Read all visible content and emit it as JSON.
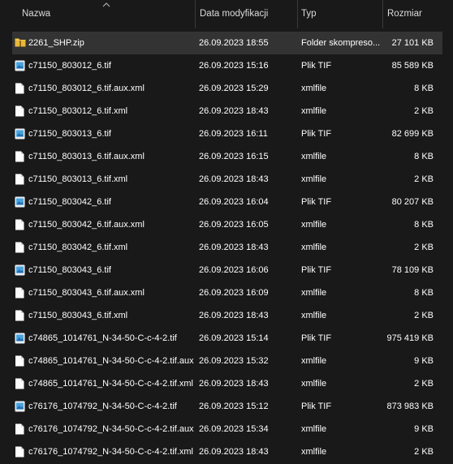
{
  "header": {
    "name": "Nazwa",
    "date": "Data modyfikacji",
    "type": "Typ",
    "size": "Rozmiar"
  },
  "colors": {
    "background": "#191919",
    "selected_row": "#333333",
    "folder_icon": "#f2c94c",
    "tif_icon": "#4aa3df"
  },
  "files": [
    {
      "name": "2261_SHP.zip",
      "date": "26.09.2023 18:55",
      "type": "Folder skompreso...",
      "size": "27 101 KB",
      "icon": "zip-folder-icon",
      "selected": true
    },
    {
      "name": "c71150_803012_6.tif",
      "date": "26.09.2023 15:16",
      "type": "Plik TIF",
      "size": "85 589 KB",
      "icon": "tif-image-icon"
    },
    {
      "name": "c71150_803012_6.tif.aux.xml",
      "date": "26.09.2023 15:29",
      "type": "xmlfile",
      "size": "8 KB",
      "icon": "xml-file-icon"
    },
    {
      "name": "c71150_803012_6.tif.xml",
      "date": "26.09.2023 18:43",
      "type": "xmlfile",
      "size": "2 KB",
      "icon": "xml-file-icon"
    },
    {
      "name": "c71150_803013_6.tif",
      "date": "26.09.2023 16:11",
      "type": "Plik TIF",
      "size": "82 699 KB",
      "icon": "tif-image-icon"
    },
    {
      "name": "c71150_803013_6.tif.aux.xml",
      "date": "26.09.2023 16:15",
      "type": "xmlfile",
      "size": "8 KB",
      "icon": "xml-file-icon"
    },
    {
      "name": "c71150_803013_6.tif.xml",
      "date": "26.09.2023 18:43",
      "type": "xmlfile",
      "size": "2 KB",
      "icon": "xml-file-icon"
    },
    {
      "name": "c71150_803042_6.tif",
      "date": "26.09.2023 16:04",
      "type": "Plik TIF",
      "size": "80 207 KB",
      "icon": "tif-image-icon"
    },
    {
      "name": "c71150_803042_6.tif.aux.xml",
      "date": "26.09.2023 16:05",
      "type": "xmlfile",
      "size": "8 KB",
      "icon": "xml-file-icon"
    },
    {
      "name": "c71150_803042_6.tif.xml",
      "date": "26.09.2023 18:43",
      "type": "xmlfile",
      "size": "2 KB",
      "icon": "xml-file-icon"
    },
    {
      "name": "c71150_803043_6.tif",
      "date": "26.09.2023 16:06",
      "type": "Plik TIF",
      "size": "78 109 KB",
      "icon": "tif-image-icon"
    },
    {
      "name": "c71150_803043_6.tif.aux.xml",
      "date": "26.09.2023 16:09",
      "type": "xmlfile",
      "size": "8 KB",
      "icon": "xml-file-icon"
    },
    {
      "name": "c71150_803043_6.tif.xml",
      "date": "26.09.2023 18:43",
      "type": "xmlfile",
      "size": "2 KB",
      "icon": "xml-file-icon"
    },
    {
      "name": "c74865_1014761_N-34-50-C-c-4-2.tif",
      "date": "26.09.2023 15:14",
      "type": "Plik TIF",
      "size": "975 419 KB",
      "icon": "tif-image-icon"
    },
    {
      "name": "c74865_1014761_N-34-50-C-c-4-2.tif.aux....",
      "date": "26.09.2023 15:32",
      "type": "xmlfile",
      "size": "9 KB",
      "icon": "xml-file-icon"
    },
    {
      "name": "c74865_1014761_N-34-50-C-c-4-2.tif.xml",
      "date": "26.09.2023 18:43",
      "type": "xmlfile",
      "size": "2 KB",
      "icon": "xml-file-icon"
    },
    {
      "name": "c76176_1074792_N-34-50-C-c-4-2.tif",
      "date": "26.09.2023 15:12",
      "type": "Plik TIF",
      "size": "873 983 KB",
      "icon": "tif-image-icon"
    },
    {
      "name": "c76176_1074792_N-34-50-C-c-4-2.tif.aux....",
      "date": "26.09.2023 15:34",
      "type": "xmlfile",
      "size": "9 KB",
      "icon": "xml-file-icon"
    },
    {
      "name": "c76176_1074792_N-34-50-C-c-4-2.tif.xml",
      "date": "26.09.2023 18:43",
      "type": "xmlfile",
      "size": "2 KB",
      "icon": "xml-file-icon"
    }
  ]
}
